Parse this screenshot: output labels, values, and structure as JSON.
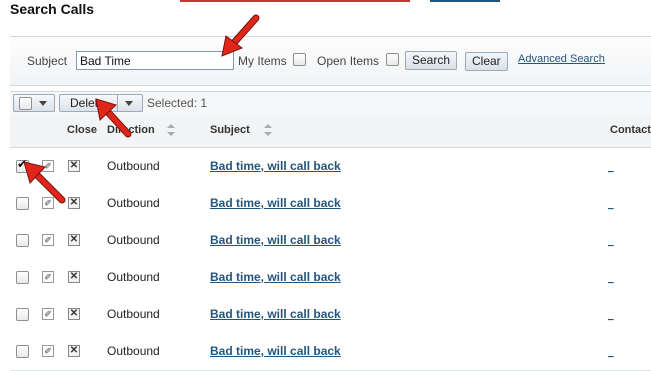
{
  "page": {
    "title": "Search Calls"
  },
  "search": {
    "subject_label": "Subject",
    "subject_value": "Bad Time",
    "my_items_label": "My Items",
    "open_items_label": "Open Items",
    "search_button": "Search",
    "clear_button": "Clear",
    "advanced_link": "Advanced Search"
  },
  "toolbar": {
    "delete_label": "Delete",
    "selected_text": "Selected: 1"
  },
  "table": {
    "headers": {
      "close": "Close",
      "direction": "Direction",
      "subject": "Subject",
      "contact": "Contact"
    },
    "rows": [
      {
        "checked": true,
        "direction": "Outbound",
        "subject": "Bad time, will call back",
        "contact": "_"
      },
      {
        "checked": false,
        "direction": "Outbound",
        "subject": "Bad time, will call back",
        "contact": "_"
      },
      {
        "checked": false,
        "direction": "Outbound",
        "subject": "Bad time, will call back",
        "contact": "_"
      },
      {
        "checked": false,
        "direction": "Outbound",
        "subject": "Bad time, will call back",
        "contact": "_"
      },
      {
        "checked": false,
        "direction": "Outbound",
        "subject": "Bad time, will call back",
        "contact": "_"
      },
      {
        "checked": false,
        "direction": "Outbound",
        "subject": "Bad time, will call back",
        "contact": "_"
      }
    ]
  },
  "colors": {
    "link": "#24557f",
    "annotation_arrow": "#e0261b",
    "panel_border": "#cfd6dc"
  }
}
